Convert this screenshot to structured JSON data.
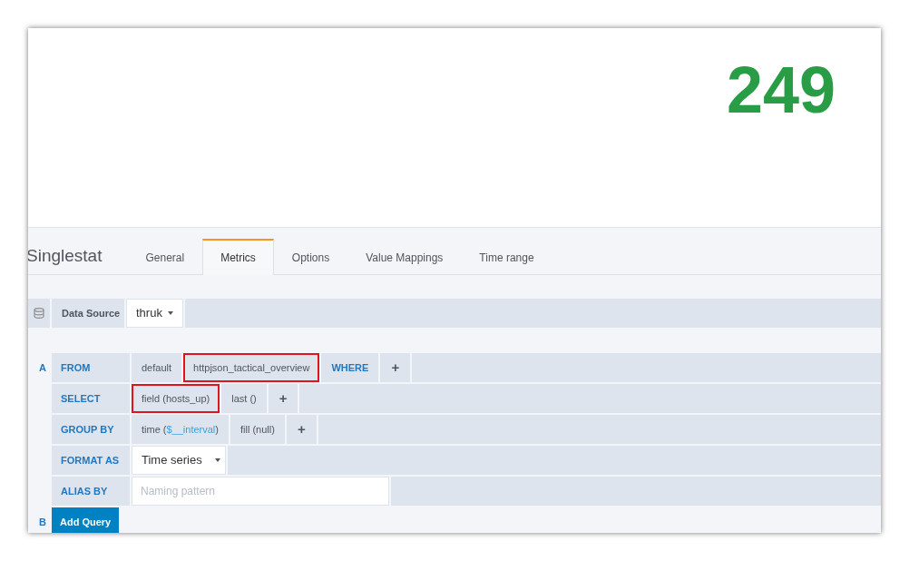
{
  "stat": {
    "value": "249"
  },
  "panel": {
    "title": "Singlestat"
  },
  "tabs": [
    {
      "label": "General",
      "selected": false
    },
    {
      "label": "Metrics",
      "selected": true
    },
    {
      "label": "Options",
      "selected": false
    },
    {
      "label": "Value Mappings",
      "selected": false
    },
    {
      "label": "Time range",
      "selected": false
    }
  ],
  "datasource": {
    "label": "Data Source",
    "value": "thruk"
  },
  "query": {
    "ref": "A",
    "rows": [
      {
        "label": "FROM",
        "segments": [
          {
            "kind": "text",
            "text": "default",
            "highlighted": false
          },
          {
            "kind": "text",
            "text": "httpjson_tactical_overview",
            "highlighted": true
          },
          {
            "kind": "keyword",
            "text": "WHERE",
            "highlighted": false
          },
          {
            "kind": "plus",
            "text": "+",
            "highlighted": false
          }
        ]
      },
      {
        "label": "SELECT",
        "segments": [
          {
            "kind": "text",
            "text": "field (hosts_up)",
            "highlighted": true
          },
          {
            "kind": "text",
            "text": "last ()",
            "highlighted": false
          },
          {
            "kind": "plus",
            "text": "+",
            "highlighted": false
          }
        ]
      },
      {
        "label": "GROUP BY",
        "segments": [
          {
            "kind": "func",
            "text": "time (",
            "param": "$__interval",
            "close": ")",
            "highlighted": false
          },
          {
            "kind": "text",
            "text": "fill (null)",
            "highlighted": false
          },
          {
            "kind": "plus",
            "text": "+",
            "highlighted": false
          }
        ]
      },
      {
        "label": "FORMAT AS",
        "segments": [
          {
            "kind": "select",
            "text": "Time series"
          }
        ]
      },
      {
        "label": "ALIAS BY",
        "segments": [
          {
            "kind": "input",
            "placeholder": "Naming pattern"
          }
        ]
      }
    ]
  },
  "next_query": {
    "ref": "B",
    "button": "Add Query"
  }
}
